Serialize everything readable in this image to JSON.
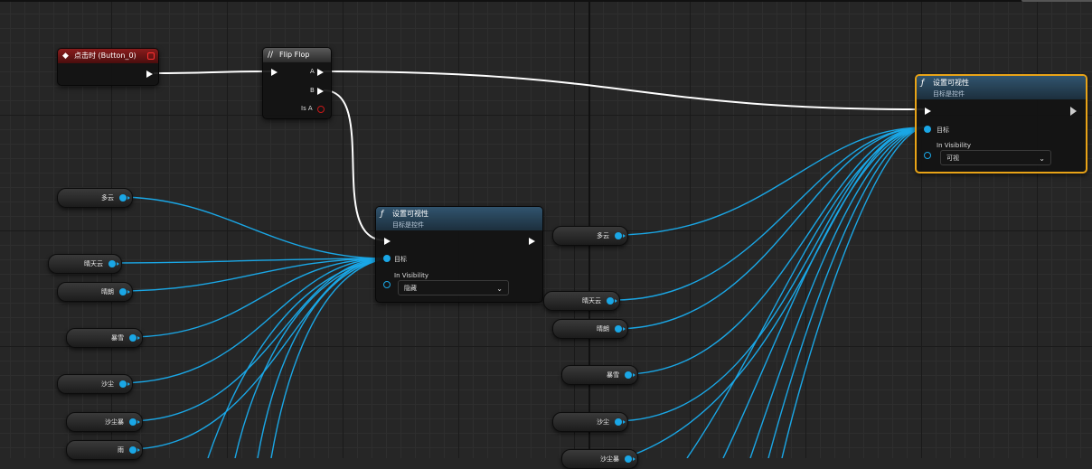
{
  "event_node": {
    "title": "点击时 (Button_0)"
  },
  "flipflop_node": {
    "title": "Flip Flop",
    "pin_a": "A",
    "pin_b": "B",
    "pin_isa": "Is A"
  },
  "set_vis_left": {
    "title": "设置可视性",
    "subtitle": "目标是控件",
    "target_label": "目标",
    "in_visibility_label": "In Visibility",
    "visibility_value": "隐藏"
  },
  "set_vis_right": {
    "title": "设置可视性",
    "subtitle": "目标是控件",
    "target_label": "目标",
    "in_visibility_label": "In Visibility",
    "visibility_value": "可视"
  },
  "left_vars": [
    {
      "label": "多云"
    },
    {
      "label": "晴天云"
    },
    {
      "label": "晴朗"
    },
    {
      "label": "暴雪"
    },
    {
      "label": "沙尘"
    },
    {
      "label": "沙尘暴"
    },
    {
      "label": "雨"
    }
  ],
  "right_vars": [
    {
      "label": "多云"
    },
    {
      "label": "晴天云"
    },
    {
      "label": "晴朗"
    },
    {
      "label": "暴雪"
    },
    {
      "label": "沙尘"
    },
    {
      "label": "沙尘暴"
    }
  ],
  "colors": {
    "exec_wire": "#ffffff",
    "object_wire": "#1aa7e6",
    "event_header": "#8a1c1c",
    "function_header": "#31546e",
    "selection": "#e8a317"
  }
}
